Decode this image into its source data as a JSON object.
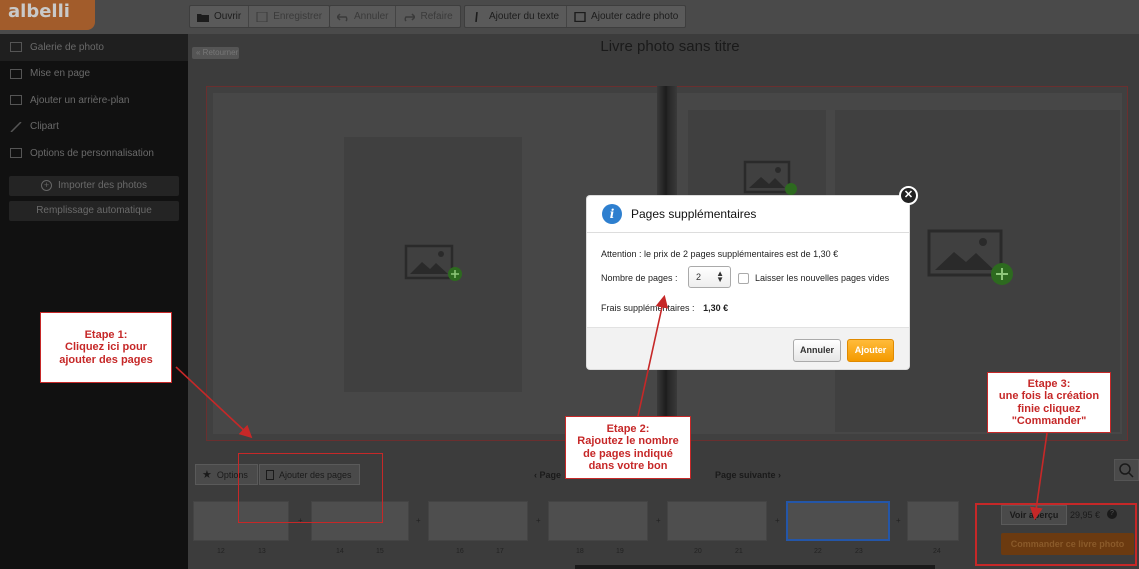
{
  "app": {
    "logo": "albelli"
  },
  "toolbar": {
    "open": "Ouvrir",
    "save": "Enregistrer",
    "undo": "Annuler",
    "redo": "Refaire",
    "add_text": "Ajouter du texte",
    "add_frame": "Ajouter cadre photo"
  },
  "sidebar": {
    "items": [
      {
        "label": "Galerie de photo",
        "icon": "gallery-icon"
      },
      {
        "label": "Mise en page",
        "icon": "layout-icon"
      },
      {
        "label": "Ajouter un arrière-plan",
        "icon": "background-icon"
      },
      {
        "label": "Clipart",
        "icon": "clipart-icon"
      },
      {
        "label": "Options de personnalisation",
        "icon": "options-icon"
      }
    ],
    "import_label": "Importer des photos",
    "autofill_label": "Remplissage automatique"
  },
  "canvas": {
    "small_tag": "« Retourner",
    "title": "Livre photo sans titre"
  },
  "modal": {
    "title": "Pages supplémentaires",
    "warning": "Attention : le prix de 2 pages supplémentaires est de 1,30 €",
    "pages_label": "Nombre de pages :",
    "pages_value": "2",
    "keep_empty_label": "Laisser les nouvelles pages vides",
    "fees_label": "Frais supplémentaires :",
    "fees_value": "1,30 €",
    "cancel": "Annuler",
    "add": "Ajouter"
  },
  "callouts": {
    "step1": [
      "Etape 1:",
      "Cliquez ici pour",
      "ajouter des pages"
    ],
    "step2": [
      "Etape 2:",
      "Rajoutez le nombre",
      "de pages indiqué",
      "dans votre bon"
    ],
    "step3": [
      "Etape 3:",
      "une fois la création",
      "finie cliquez",
      "\"Commander\""
    ]
  },
  "bottom": {
    "options": "Options",
    "add_pages": "Ajouter des pages",
    "prev_page": "Page",
    "next_page": "Page suivante",
    "thumb_numbers": [
      "12",
      "13",
      "14",
      "15",
      "16",
      "17",
      "18",
      "19",
      "20",
      "21",
      "22",
      "23",
      "24"
    ]
  },
  "order": {
    "preview": "Voir aperçu",
    "price": "29,95 €",
    "order_button": "Commander ce livre photo"
  },
  "colors": {
    "accent_orange": "#f49a00",
    "annotation_red": "#c62828",
    "info_blue": "#2e7fcf"
  }
}
